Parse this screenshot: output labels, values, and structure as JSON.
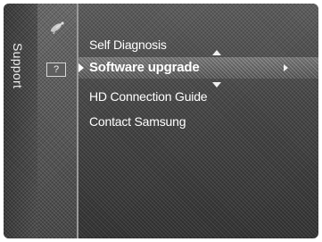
{
  "sidebar": {
    "title": "Support"
  },
  "icons": {
    "category_icon": "satellite-dish-icon",
    "help_icon": "help-question-icon",
    "help_symbol": "?"
  },
  "menu": {
    "items": [
      {
        "label": "Self Diagnosis"
      },
      {
        "label": "Software upgrade",
        "selected": true
      },
      {
        "label": "HD Connection Guide"
      },
      {
        "label": "Contact Samsung"
      }
    ]
  },
  "colors": {
    "text": "#ffffff",
    "panel_dark": "#333333",
    "panel_light": "#5c5c5c",
    "divider": "#9a9a9a"
  }
}
